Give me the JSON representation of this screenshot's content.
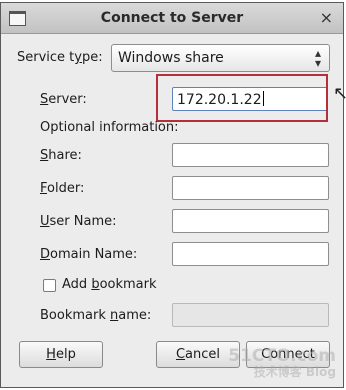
{
  "window": {
    "title": "Connect to Server",
    "close_icon": "×"
  },
  "service_type": {
    "label_before": "Service t",
    "label_underlined": "y",
    "label_after": "pe:",
    "value": "Windows share"
  },
  "server": {
    "label_underlined": "S",
    "label_after": "erver:",
    "value": "172.20.1.22"
  },
  "optional_info": "Optional information:",
  "share": {
    "label_underlined": "S",
    "label_after": "hare:",
    "value": ""
  },
  "folder": {
    "label_underlined": "F",
    "label_after": "older:",
    "value": ""
  },
  "user_name": {
    "label_underlined": "U",
    "label_after": "ser Name:",
    "value": ""
  },
  "domain_name": {
    "label_underlined": "D",
    "label_after": "omain Name:",
    "value": ""
  },
  "add_bookmark": {
    "label_before": "Add ",
    "label_underlined": "b",
    "label_after": "ookmark",
    "checked": false
  },
  "bookmark_name": {
    "label_before": "Bookmark ",
    "label_underlined": "n",
    "label_after": "ame:",
    "value": ""
  },
  "buttons": {
    "help": {
      "underlined": "H",
      "rest": "elp"
    },
    "cancel": {
      "underlined": "C",
      "rest": "ancel"
    },
    "connect": {
      "underlined": "",
      "rest": "Connect"
    }
  },
  "watermark": {
    "line1": "51CTO.com",
    "line2": "技术博客 Blog"
  },
  "colors": {
    "highlight": "#b3303a",
    "focus": "#5e83b8"
  }
}
